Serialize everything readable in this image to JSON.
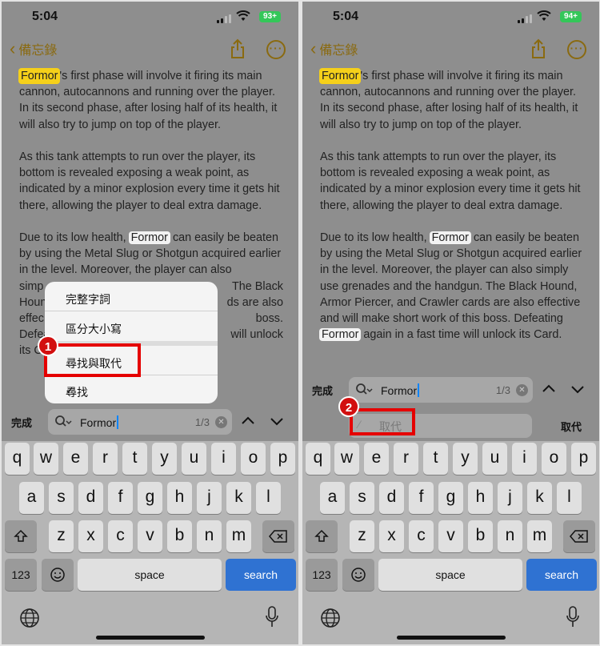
{
  "status": {
    "time": "5:04",
    "battery_left": "93+",
    "battery_right": "94+"
  },
  "nav": {
    "back_label": "備忘錄"
  },
  "note": {
    "p1_word": "Formor",
    "p1_rest": "'s first phase will involve it firing its main cannon, autocannons and running over the player. In its second phase, after losing half of its health, it will also try to jump on top of the player.",
    "p2": "As this tank attempts to run over the player, its bottom is revealed exposing a weak point, as indicated by a minor explosion every time it gets hit there, allowing the player to deal extra damage.",
    "p3_a": "Due to its low health,",
    "p3_word": "Formor",
    "p3_b": "can easily be beaten by using the Metal Slug or Shotgun acquired earlier in the level. Moreover, the player can also simply use grenades and the handgun. The Black Hound, Armor Piercer, and Crawler cards are also effective and will make short work of this boss. Defeating",
    "p3_word2": "Formor",
    "p3_c": "again in a fast time will unlock its Card."
  },
  "left_note_visible": {
    "p3_a": "Due to its low health,",
    "p3_b": "can easily be beaten by using the Metal Slug or Shotgun acquired earlier in the level. Moreover, the player can also",
    "l1": "simp",
    "l1r": "The Black",
    "l2": "Houn",
    "l2r": "ds are also",
    "l3": "effec",
    "l3r": "boss.",
    "l4": "Defea",
    "l4r": "will unlock",
    "l5": "its C"
  },
  "find": {
    "done_label": "完成",
    "query": "Formor",
    "count": "1/3",
    "replace_placeholder": "取代",
    "replace_button": "取代"
  },
  "menu": {
    "whole_words": "完整字詞",
    "match_case": "區分大小寫",
    "find_replace": "尋找與取代",
    "find": "尋找"
  },
  "annotations": {
    "step1": "1",
    "step2": "2"
  },
  "keyboard": {
    "row1": [
      "q",
      "w",
      "e",
      "r",
      "t",
      "y",
      "u",
      "i",
      "o",
      "p"
    ],
    "row2": [
      "a",
      "s",
      "d",
      "f",
      "g",
      "h",
      "j",
      "k",
      "l"
    ],
    "row3": [
      "z",
      "x",
      "c",
      "v",
      "b",
      "n",
      "m"
    ],
    "numbers": "123",
    "space": "space",
    "search": "search"
  }
}
